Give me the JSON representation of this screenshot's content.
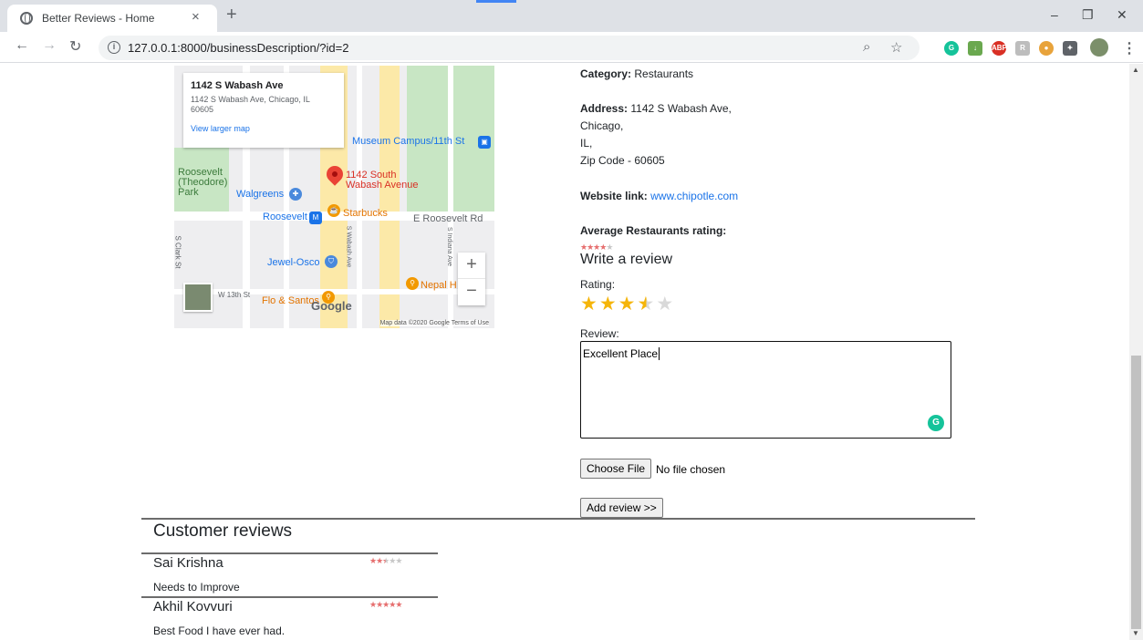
{
  "browser": {
    "tab_title": "Better Reviews - Home",
    "tab_close": "×",
    "new_tab": "+",
    "url": "127.0.0.1:8000/businessDescription/?id=2",
    "window_controls": {
      "minimize": "–",
      "restore": "❐",
      "close": "✕"
    }
  },
  "map": {
    "infobox": {
      "title": "1142 S Wabash Ave",
      "address": "1142 S Wabash Ave, Chicago, IL 60605",
      "link": "View larger map"
    },
    "labels": {
      "museum": "Museum Campus/11th St",
      "pin": "1142 South Wabash Avenue",
      "roosevelt_park": "Roosevelt (Theodore) Park",
      "walgreens": "Walgreens",
      "roosevelt_station": "Roosevelt",
      "starbucks": "Starbucks",
      "e_roosevelt": "E Roosevelt Rd",
      "jewel": "Jewel-Osco",
      "nepal": "Nepal H",
      "w13": "W 13th St",
      "flo": "Flo & Santos",
      "clark": "S Clark St",
      "wabash": "S Wabash Ave",
      "indiana": "S Indiana Ave"
    },
    "google": "Google",
    "footer": "Map data ©2020 Google   Terms of Use"
  },
  "business": {
    "category_label": "Category:",
    "category": "Restaurants",
    "address_label": "Address:",
    "address_street": "1142 S Wabash Ave,",
    "address_city": "Chicago,",
    "address_state": "IL,",
    "address_zip": "Zip Code - 60605",
    "website_label": "Website link:",
    "website": "www.chipotle.com",
    "avg_rating_label": "Average Restaurants rating:",
    "avg_rating": 4
  },
  "review_form": {
    "title": "Write a review",
    "rating_label": "Rating:",
    "rating_value": 3.5,
    "review_label": "Review:",
    "review_text": "Excellent Place",
    "choose_file": "Choose File",
    "file_status": "No file chosen",
    "submit": "Add review >>"
  },
  "customer_reviews": {
    "title": "Customer reviews",
    "items": [
      {
        "name": "Sai Krishna",
        "rating": 2.5,
        "text": "Needs to Improve"
      },
      {
        "name": "Akhil Kovvuri",
        "rating": 5,
        "text": "Best Food I have ever had."
      }
    ]
  },
  "colors": {
    "star_small": "#e66e6e",
    "star_large": "#f5b50a",
    "link": "#1a73e8",
    "pin": "#ea4335"
  }
}
